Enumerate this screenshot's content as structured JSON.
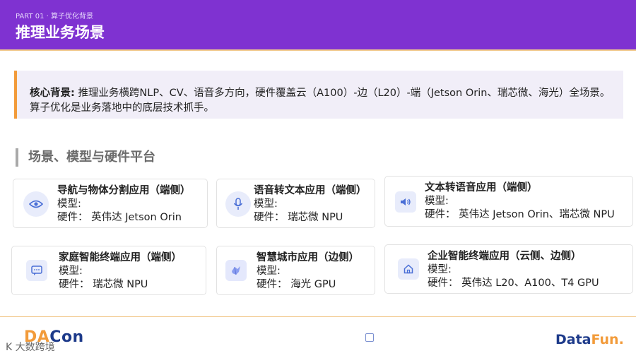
{
  "header": {
    "crumb_part": "PART 01",
    "crumb_sep": "·",
    "crumb_topic": "算子优化背景",
    "title": "推理业务场景"
  },
  "callout": {
    "label": "核心背景:",
    "text": " 推理业务横跨NLP、CV、语音多方向，硬件覆盖云（A100）-边（L20）-端（Jetson Orin、瑞芯微、海光）全场景。算子优化是业务落地中的底层技术抓手。"
  },
  "section": {
    "title": "场景、模型与硬件平台"
  },
  "cards": [
    {
      "title": "导航与物体分割应用（端侧）",
      "model": "模型:",
      "hardware": "硬件： 英伟达 Jetson Orin",
      "icon": "eye-icon"
    },
    {
      "title": "语音转文本应用（端侧）",
      "model": "模型:",
      "hardware": "硬件： 瑞芯微 NPU",
      "icon": "microphone-icon"
    },
    {
      "title": "文本转语音应用（端侧）",
      "model": "模型:",
      "hardware": "硬件： 英伟达 Jetson Orin、瑞芯微 NPU",
      "icon": "speaker-icon"
    },
    {
      "title": "家庭智能终端应用（端侧）",
      "model": "模型:",
      "hardware": "硬件： 瑞芯微 NPU",
      "icon": "chat-icon"
    },
    {
      "title": "智慧城市应用（边侧）",
      "model": "模型:",
      "hardware": "硬件： 海光 GPU",
      "icon": "city-icon"
    },
    {
      "title": "企业智能终端应用（云侧、边侧）",
      "model": "模型:",
      "hardware": "硬件： 英伟达 L20、A100、T4 GPU",
      "icon": "home-icon"
    }
  ],
  "footer": {
    "left_logo_a": "DA",
    "left_logo_b": "Con",
    "left_sub": "K 大数跨境",
    "right_logo_a": "Data",
    "right_logo_b": "Fun."
  },
  "colors": {
    "header": "#7f32d1",
    "accent": "#f29b3a",
    "brand_blue": "#1d3a8a"
  }
}
